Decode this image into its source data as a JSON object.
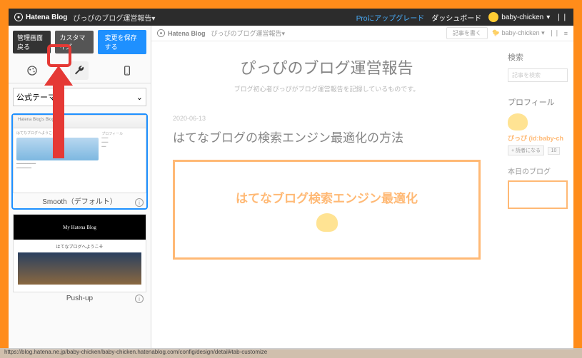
{
  "topbar": {
    "service": "Hatena Blog",
    "blogname": "ぴっぴのブログ運営報告▾",
    "pro": "Proにアップグレード",
    "dashboard": "ダッシュボード",
    "username": "baby-chicken",
    "chevron": "▾"
  },
  "sidebar": {
    "back": "管理画面戻る",
    "customize": "カスタマイズ",
    "save": "変更を保存する",
    "select_value": "公式テーマ",
    "themes": [
      {
        "title": "Smooth（デフォルト）",
        "heading": "Hatena Blog's Blog",
        "sub": "はてなブログへようこそ"
      },
      {
        "title": "Push-up",
        "heading": "My Hatena Blog",
        "sub": "はてなブログへようこそ"
      }
    ]
  },
  "preview": {
    "service": "Hatena Blog",
    "blogname": "ぴっぴのブログ運営報告▾",
    "writebtn": "記事を書く",
    "username": "baby-chicken",
    "title": "ぴっぴのブログ運営報告",
    "subtitle": "ブログ初心者ぴっぴがブログ運営報告を記録しているものです。",
    "date": "2020-06-13",
    "article_title": "はてなブログの検索エンジン最適化の方法",
    "card_text": "はてなブログ検索エンジン最適化",
    "side": {
      "search_h": "検索",
      "search_ph": "記事を検索",
      "profile_h": "プロフィール",
      "profile_name": "ぴっぴ (id:baby-ch",
      "follow": "読者になる",
      "follow_count": "10",
      "today_h": "本日のブログ"
    }
  },
  "status": "https://blog.hatena.ne.jp/baby-chicken/baby-chicken.hatenablog.com/config/design/detail#tab-customize"
}
